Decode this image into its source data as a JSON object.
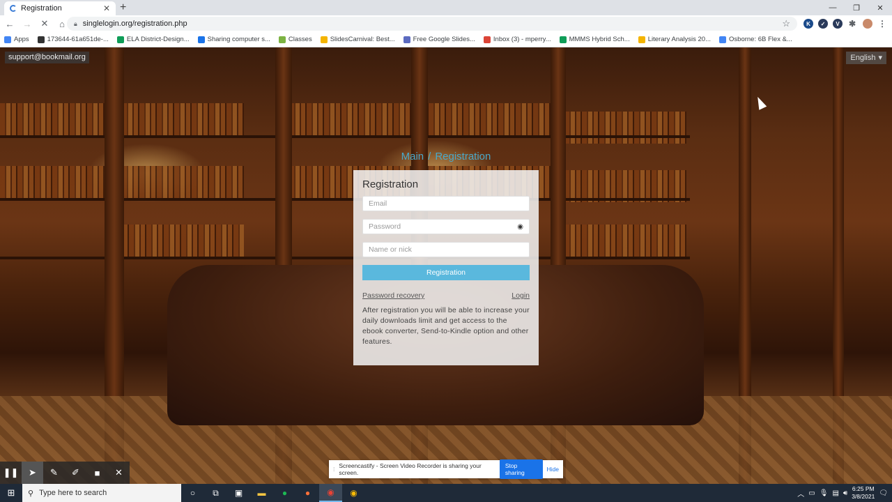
{
  "browser": {
    "tab_title": "Registration",
    "url": "singlelogin.org/registration.php",
    "bookmarks": [
      {
        "label": "Apps",
        "color": "#4285f4"
      },
      {
        "label": "173644-61a651de-...",
        "color": "#333333"
      },
      {
        "label": "ELA District-Design...",
        "color": "#0f9d58"
      },
      {
        "label": "Sharing computer s...",
        "color": "#1a73e8"
      },
      {
        "label": "Classes",
        "color": "#7cb342"
      },
      {
        "label": "SlidesCarnival: Best...",
        "color": "#f4b400"
      },
      {
        "label": "Free Google Slides...",
        "color": "#5c6bc0"
      },
      {
        "label": "Inbox (3) - mperry...",
        "color": "#db4437"
      },
      {
        "label": "MMMS Hybrid Sch...",
        "color": "#0f9d58"
      },
      {
        "label": "Literary Analysis 20...",
        "color": "#f4b400"
      },
      {
        "label": "Osborne: 6B Flex &...",
        "color": "#4285f4"
      }
    ]
  },
  "page": {
    "support_email": "support@bookmail.org",
    "language": "English",
    "breadcrumb": {
      "main": "Main",
      "separator": "/",
      "current": "Registration"
    }
  },
  "form": {
    "title": "Registration",
    "email_placeholder": "Email",
    "password_placeholder": "Password",
    "name_placeholder": "Name or nick",
    "submit_label": "Registration",
    "recovery_link": "Password recovery",
    "login_link": "Login",
    "note": "After registration you will be able to increase your daily downloads limit and get access to the ebook converter, Send-to-Kindle option and other features."
  },
  "screencastify": {
    "message": "Screencastify - Screen Video Recorder is sharing your screen.",
    "stop_label": "Stop sharing",
    "hide_label": "Hide"
  },
  "taskbar": {
    "search_placeholder": "Type here to search",
    "time": "6:25 PM",
    "date": "3/8/2021"
  }
}
